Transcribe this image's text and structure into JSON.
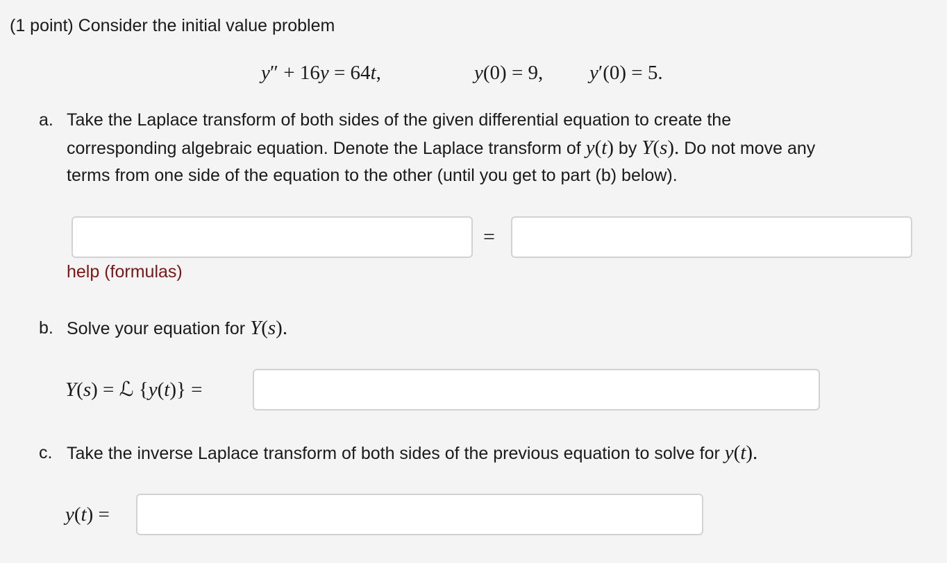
{
  "header": {
    "points": "(1 point)",
    "intro": "Consider the initial value problem"
  },
  "equation": {
    "de_lhs_y": "y",
    "de_lhs_prime": "″",
    "de_mid": " + 16",
    "de_y2": "y",
    "de_eq": " = 64",
    "de_t": "t",
    "de_comma": ",",
    "ic1_y": "y",
    "ic1_rest": "(0) = 9,",
    "ic2_y": "y",
    "ic2_prime": "′",
    "ic2_rest": "(0) = 5."
  },
  "part_a": {
    "label": "a.",
    "line1": "Take the Laplace transform of both sides of the given differential equation to create the",
    "line2_pre": "corresponding algebraic equation. Denote the Laplace transform of ",
    "line2_y": "y",
    "line2_paren_open": "(",
    "line2_t": "t",
    "line2_paren_close": ")",
    "line2_by": " by ",
    "line2_Y": "Y",
    "line2_s_open": "(",
    "line2_s": "s",
    "line2_s_close": ").",
    "line2_post": " Do not move any",
    "line3": "terms from one side of the equation to the other (until you get to part (b) below).",
    "equals": "=",
    "left_value": "",
    "right_value": "",
    "help": "help (formulas)"
  },
  "part_b": {
    "label": "b.",
    "text": "Solve your equation for ",
    "Y": "Y",
    "s_open": "(",
    "s": "s",
    "s_close": ").",
    "lhs_Y": "Y",
    "lhs_s_open": "(",
    "lhs_s": "s",
    "lhs_s_close": ")",
    "lhs_eq": " = ",
    "lhs_L": "ℒ",
    "lhs_brace_open": " {",
    "lhs_y": "y",
    "lhs_t_open": "(",
    "lhs_t": "t",
    "lhs_t_close": ")",
    "lhs_brace_close": "} =",
    "value": ""
  },
  "part_c": {
    "label": "c.",
    "text": "Take the inverse Laplace transform of both sides of the previous equation to solve for ",
    "y": "y",
    "t_open": "(",
    "t": "t",
    "t_close": ").",
    "lhs_y": "y",
    "lhs_t_open": "(",
    "lhs_t": "t",
    "lhs_t_close": ")",
    "lhs_eq": " =",
    "value": ""
  }
}
